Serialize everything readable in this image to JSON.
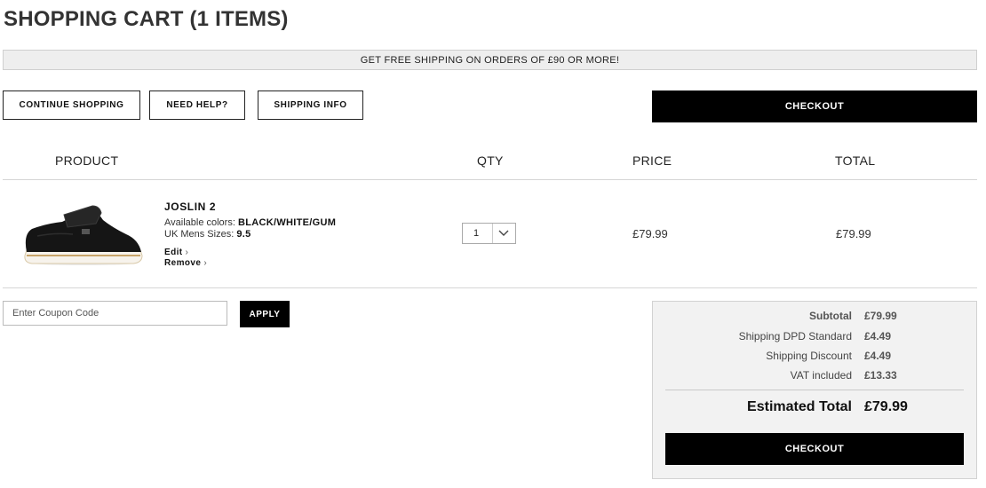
{
  "page": {
    "title": "SHOPPING CART (1 ITEMS)",
    "promo": "GET FREE SHIPPING ON ORDERS OF £90 OR MORE!"
  },
  "actions": {
    "continue_shopping": "CONTINUE SHOPPING",
    "need_help": "NEED HELP?",
    "shipping_info": "SHIPPING INFO",
    "checkout": "CHECKOUT"
  },
  "table": {
    "headers": [
      "PRODUCT",
      "QTY",
      "PRICE",
      "TOTAL"
    ]
  },
  "item": {
    "image_icon": "shoe-image",
    "name": "JOSLIN 2",
    "colors_label": "Available colors:",
    "colors_value": "BLACK/WHITE/GUM",
    "sizes_label": "UK Mens Sizes:",
    "sizes_value": "9.5",
    "edit_label": "Edit",
    "remove_label": "Remove",
    "qty": "1",
    "price": "£79.99",
    "total": "£79.99"
  },
  "coupon": {
    "placeholder": "Enter Coupon Code",
    "apply_label": "APPLY"
  },
  "summary": {
    "subtotal_label": "Subtotal",
    "subtotal_value": "£79.99",
    "shipping_label": "Shipping DPD Standard",
    "shipping_value": "£4.49",
    "discount_label": "Shipping Discount",
    "discount_value": "£4.49",
    "vat_label": "VAT included",
    "vat_value": "£13.33",
    "estimated_label": "Estimated Total",
    "estimated_value": "£79.99",
    "checkout_label": "CHECKOUT"
  },
  "colors": {
    "button_black": "#000000",
    "promo_bg": "#eeeeee",
    "summary_bg": "#f2f2f2"
  }
}
